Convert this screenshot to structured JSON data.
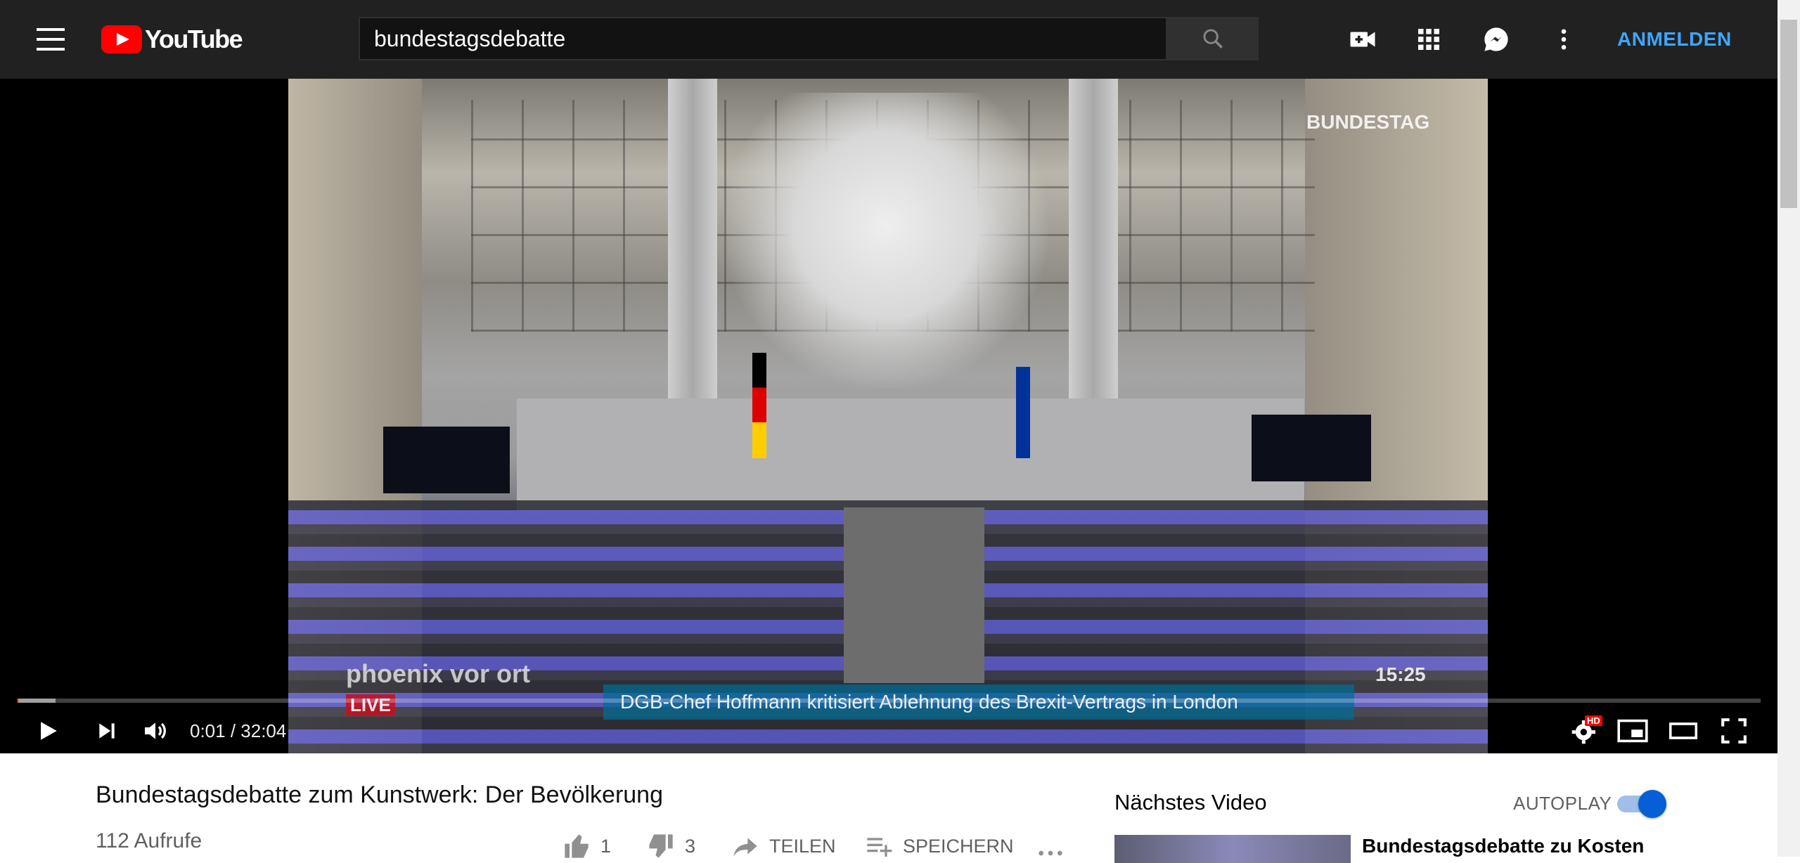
{
  "masthead": {
    "logo_text": "YouTube",
    "search_value": "bundestagsdebatte",
    "signin_label": "ANMELDEN"
  },
  "player": {
    "overlay_channel": "BUNDESTAG",
    "overlay_brand": "phoenix vor ort",
    "overlay_live": "LIVE",
    "overlay_ticker": "DGB-Chef Hoffmann kritisiert Ablehnung des Brexit-Vertrags in London",
    "overlay_clock": "15:25",
    "time_display": "0:01 / 32:04",
    "progress_played_fraction": 0.001,
    "progress_loaded_fraction": 0.022,
    "hd_badge": "HD"
  },
  "video": {
    "title": "Bundestagsdebatte zum Kunstwerk: Der Bevölkerung",
    "views": "112 Aufrufe",
    "likes": "1",
    "dislikes": "3",
    "share_label": "TEILEN",
    "save_label": "SPEICHERN"
  },
  "sidebar": {
    "up_next_label": "Nächstes Video",
    "autoplay_label": "AUTOPLAY",
    "autoplay_on": true,
    "next_video_title": "Bundestagsdebatte zu Kosten"
  },
  "colors": {
    "masthead_bg": "#212121",
    "accent_blue": "#3ea6ff",
    "progress_red": "#ff0000",
    "toggle_blue": "#065fd4"
  }
}
